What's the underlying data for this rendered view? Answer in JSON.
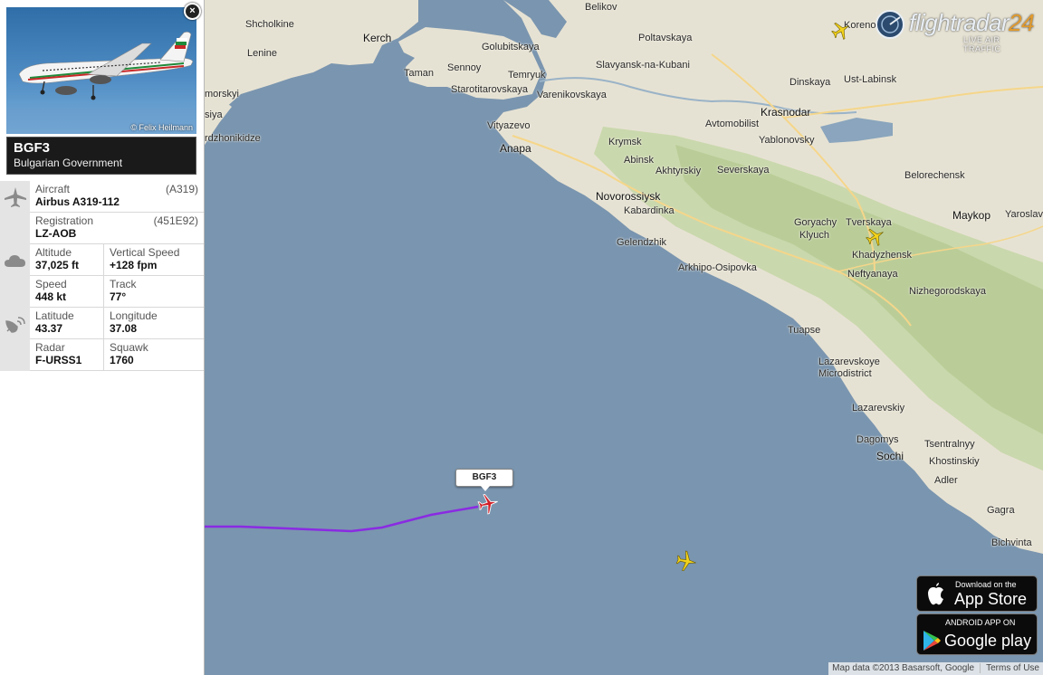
{
  "flight": {
    "callsign": "BGF3",
    "airline": "Bulgarian Government",
    "photo_credit": "© Felix Heilmann",
    "close_label": "×"
  },
  "details": {
    "aircraft": {
      "label": "Aircraft",
      "value": "Airbus A319-112",
      "code": "(A319)"
    },
    "registration": {
      "label": "Registration",
      "value": "LZ-AOB",
      "code": "(451E92)"
    },
    "altitude": {
      "label": "Altitude",
      "value": "37,025 ft"
    },
    "vertical_speed": {
      "label": "Vertical Speed",
      "value": "+128 fpm"
    },
    "speed": {
      "label": "Speed",
      "value": "448 kt"
    },
    "track": {
      "label": "Track",
      "value": "77°"
    },
    "latitude": {
      "label": "Latitude",
      "value": "43.37"
    },
    "longitude": {
      "label": "Longitude",
      "value": "37.08"
    },
    "radar": {
      "label": "Radar",
      "value": "F-URSS1"
    },
    "squawk": {
      "label": "Squawk",
      "value": "1760"
    }
  },
  "map": {
    "places": {
      "belikov": "Belikov",
      "shcholkine": "Shcholkine",
      "kerch": "Kerch",
      "lenine": "Lenine",
      "golubitskaya": "Golubitskaya",
      "taman": "Taman",
      "sennoy": "Sennoy",
      "temryuk": "Temryuk",
      "poltavskaya": "Poltavskaya",
      "slavyansk": "Slavyansk-na-Kubani",
      "starotitarovskaya": "Starotitarovskaya",
      "varenikovskaya": "Varenikovskaya",
      "morskyi": "morskyi",
      "siya": "siya",
      "rdzhonikidze": "rdzhonikidze",
      "vityazevo": "Vityazevo",
      "anapa": "Anapa",
      "krymsk": "Krymsk",
      "abinsk": "Abinsk",
      "akhtyrskiy": "Akhtyrskiy",
      "severskaya": "Severskaya",
      "avtomobilist": "Avtomobilist",
      "krasnodar": "Krasnodar",
      "yablonovsky": "Yablonovsky",
      "dinskaya": "Dinskaya",
      "ust_labinsk": "Ust-Labinsk",
      "korenovsk": "Korenovsk",
      "novorossiysk": "Novorossiysk",
      "kabardinka": "Kabardinka",
      "gelendzhik": "Gelendzhik",
      "arkhipo": "Arkhipo-Osipovka",
      "goryachy": "Goryachy",
      "klyuch": "Klyuch",
      "tverskaya": "Tverskaya",
      "khadyzhensk": "Khadyzhensk",
      "neftyanaya": "Neftyanaya",
      "belorechensk": "Belorechensk",
      "maykop": "Maykop",
      "yaroslav": "Yaroslav",
      "nizhegorodskaya": "Nizhegorodskaya",
      "tuapse": "Tuapse",
      "lazarevskoye": "Lazarevskoye",
      "microdistrict": "Microdistrict",
      "lazarevskiy": "Lazarevskiy",
      "dagomys": "Dagomys",
      "sochi": "Sochi",
      "tsentralnyy": "Tsentralnyy",
      "khostinskiy": "Khostinskiy",
      "adler": "Adler",
      "gagra": "Gagra",
      "bichvinta": "Bichvinta"
    },
    "selected_tag": "BGF3",
    "logo_text": "flightradar",
    "logo_num": "24",
    "logo_sub": "LIVE AIR TRAFFIC",
    "attribution": "Map data ©2013 Basarsoft, Google",
    "terms": "Terms of Use"
  },
  "stores": {
    "appstore_small": "Download on the",
    "appstore_large": "App Store",
    "play_small": "ANDROID APP ON",
    "play_large": "Google play"
  },
  "colors": {
    "trail": "#8a2be2",
    "selected_plane": "#d0202a",
    "other_planes": "#f2d21b",
    "sea": "#7a95af",
    "land": "#e6e2d3"
  }
}
